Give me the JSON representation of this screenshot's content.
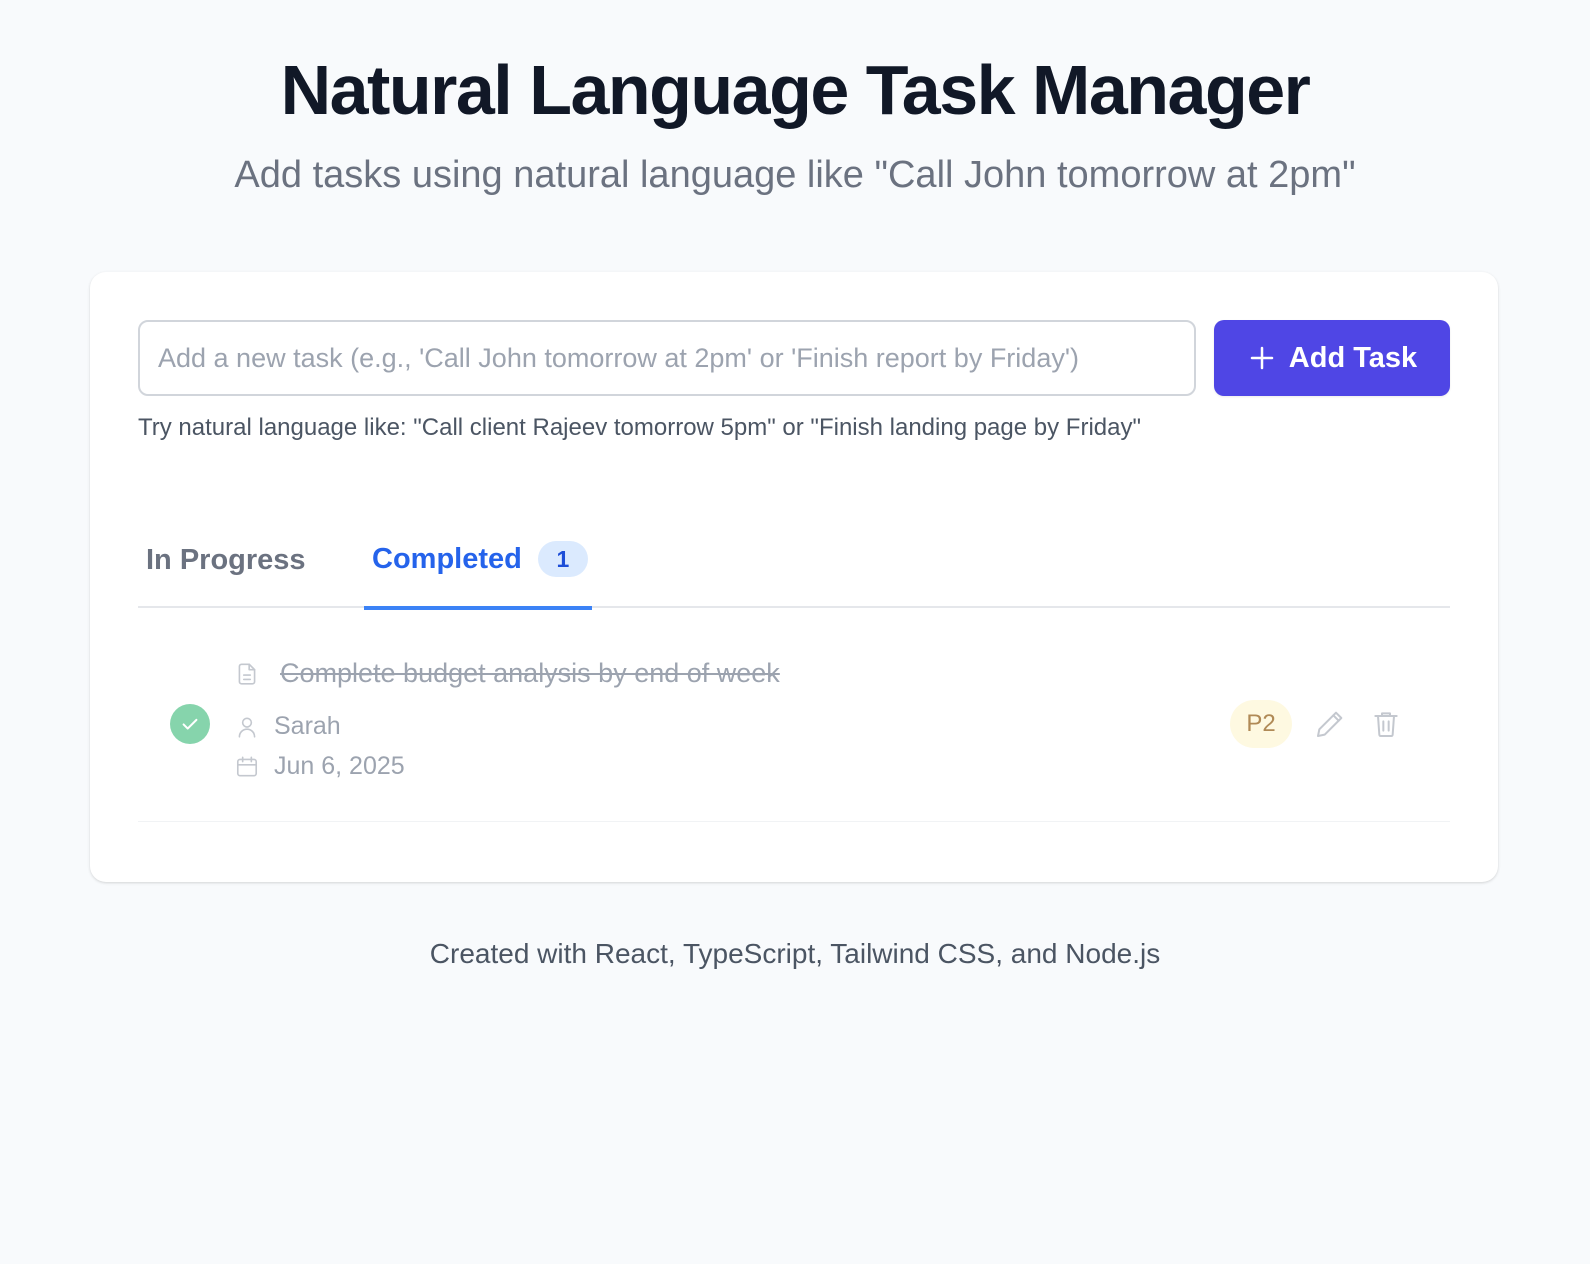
{
  "header": {
    "title": "Natural Language Task Manager",
    "subtitle": "Add tasks using natural language like \"Call John tomorrow at 2pm\""
  },
  "composer": {
    "input_value": "",
    "input_placeholder": "Add a new task (e.g., 'Call John tomorrow at 2pm' or 'Finish report by Friday')",
    "add_button_label": "Add Task",
    "hint": "Try natural language like: \"Call client Rajeev tomorrow 5pm\" or \"Finish landing page by Friday\""
  },
  "tabs": [
    {
      "label": "In Progress",
      "active": false
    },
    {
      "label": "Completed",
      "active": true,
      "count": "1"
    }
  ],
  "tasks": [
    {
      "title": "Complete budget analysis by end of week",
      "assignee": "Sarah",
      "due": "Jun 6, 2025",
      "priority": "P2",
      "completed": true
    }
  ],
  "footer": {
    "text": "Created with React, TypeScript, Tailwind CSS, and Node.js"
  },
  "colors": {
    "accent": "#4f46e5",
    "tab_active": "#2563eb",
    "completed_green": "#86d4ac",
    "priority_bg": "#fef9e1",
    "priority_text": "#b08a56"
  },
  "icons": {
    "add": "plus-icon",
    "task": "file-text-icon",
    "assignee": "user-icon",
    "due": "calendar-icon",
    "completed": "check-icon",
    "edit": "pencil-icon",
    "delete": "trash-icon"
  }
}
